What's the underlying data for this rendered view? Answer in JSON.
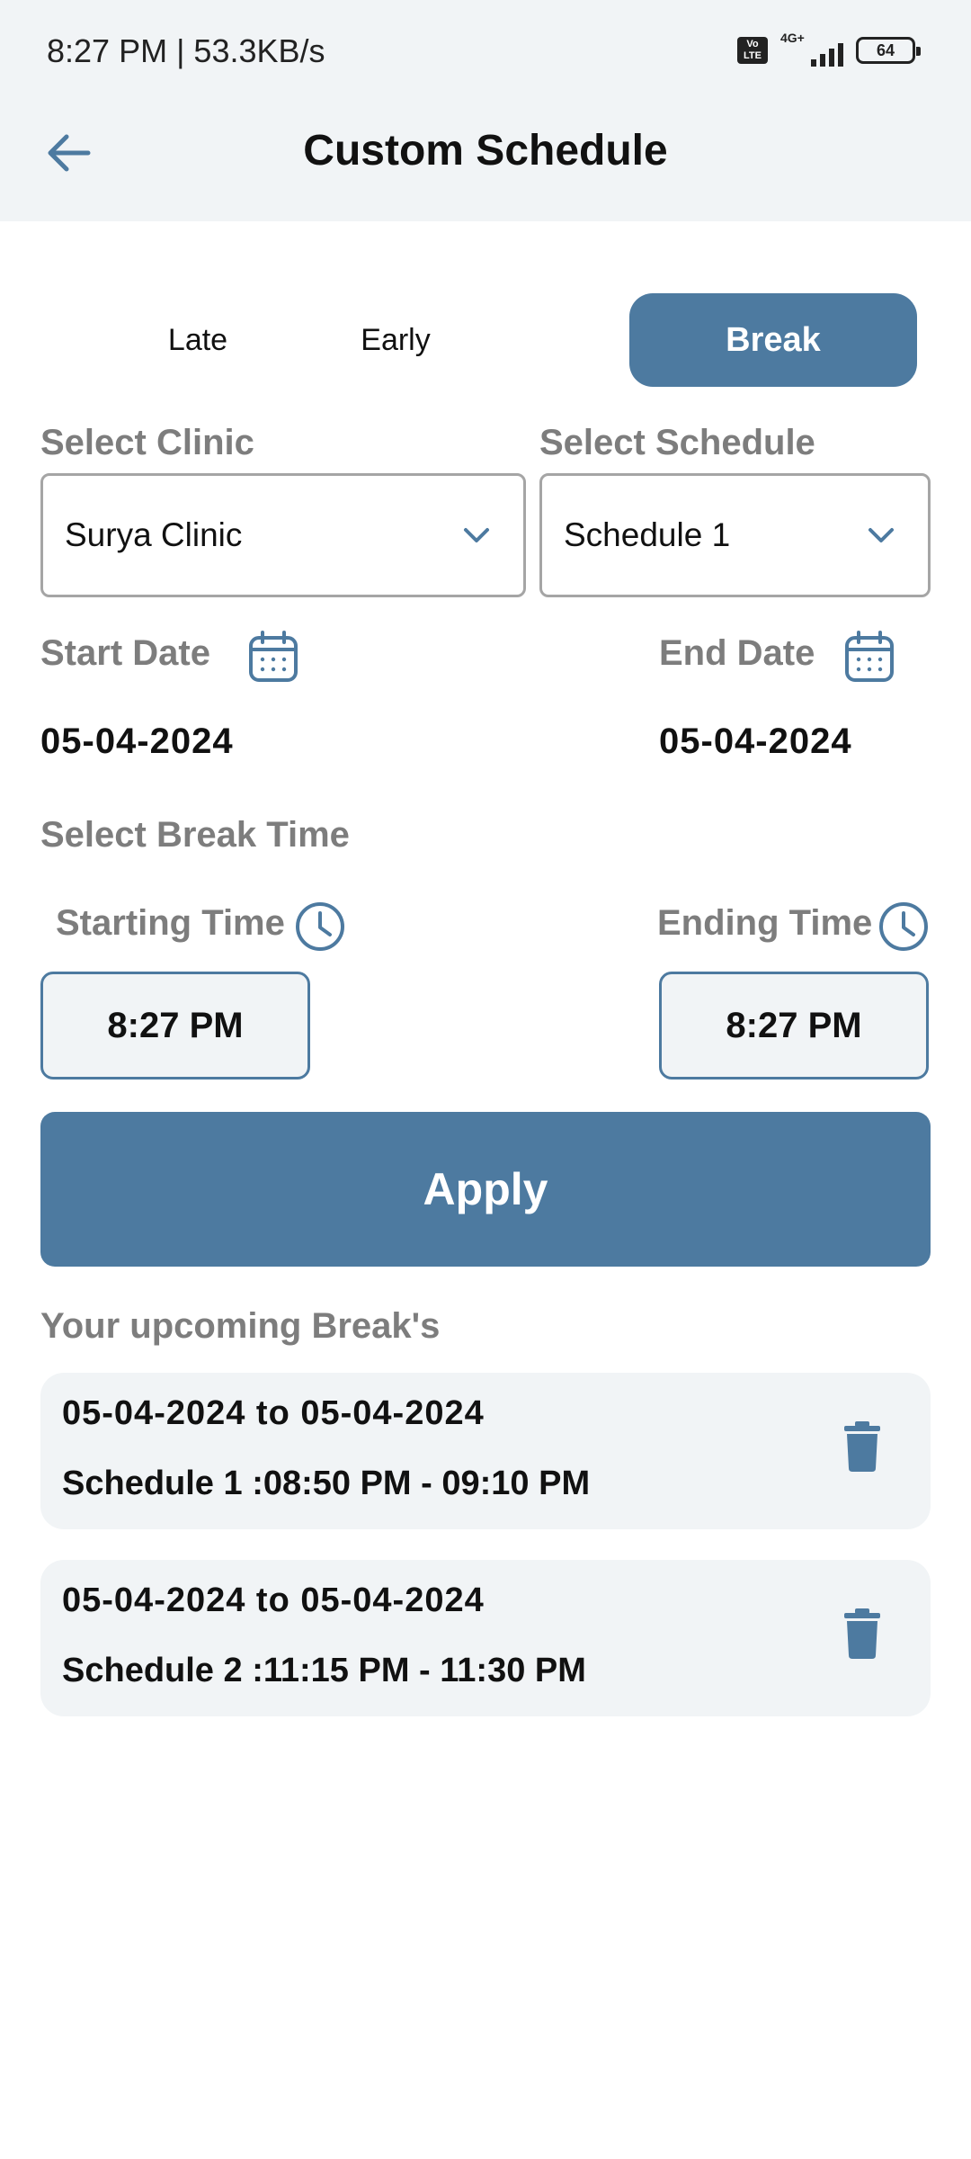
{
  "status_bar": {
    "time_speed": "8:27 PM | 53.3KB/s",
    "volte": "Vo LTE",
    "network": "4G+",
    "battery": "64"
  },
  "header": {
    "title": "Custom Schedule",
    "back_icon": "arrow-left-icon"
  },
  "tabs": [
    {
      "label": "Late",
      "active": false
    },
    {
      "label": "Early",
      "active": false
    },
    {
      "label": "Break",
      "active": true
    }
  ],
  "clinic": {
    "label": "Select Clinic",
    "value": "Surya Clinic"
  },
  "schedule": {
    "label": "Select Schedule",
    "value": "Schedule 1"
  },
  "start_date": {
    "label": "Start Date",
    "value": "05-04-2024",
    "icon": "calendar-icon"
  },
  "end_date": {
    "label": "End Date",
    "value": "05-04-2024",
    "icon": "calendar-icon"
  },
  "break_time": {
    "label": "Select Break Time",
    "starting_label": "Starting Time",
    "starting_value": "8:27 PM",
    "ending_label": "Ending Time",
    "ending_value": "8:27 PM"
  },
  "apply_label": "Apply",
  "upcoming": {
    "heading": "Your upcoming Break's",
    "items": [
      {
        "range": "05-04-2024 to 05-04-2024",
        "schedule": "Schedule 1 :08:50 PM - 09:10 PM"
      },
      {
        "range": "05-04-2024 to 05-04-2024",
        "schedule": "Schedule 2 :11:15 PM - 11:30 PM"
      }
    ]
  },
  "colors": {
    "accent": "#4d7aa0",
    "label_gray": "#7d7d7d",
    "card_bg": "#f1f4f6"
  }
}
